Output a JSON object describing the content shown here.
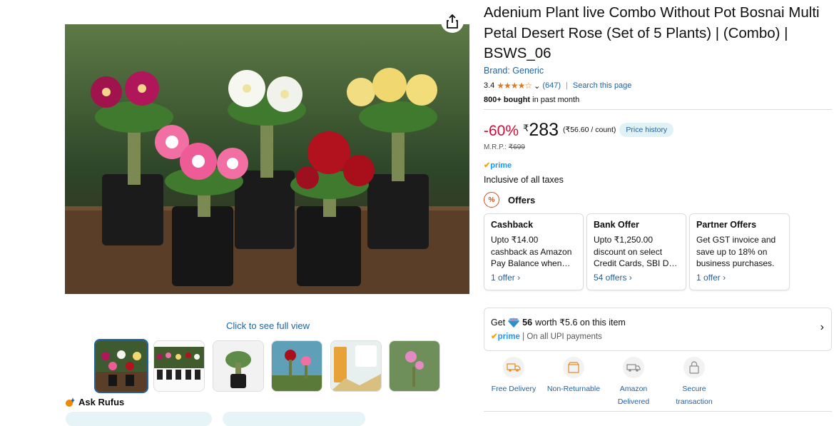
{
  "product": {
    "title": "Adenium Plant live Combo Without Pot Bosnai Multi Petal Desert Rose (Set of 5 Plants) | (Combo) | BSWS_06",
    "brand": "Brand: Generic",
    "rating": "3.4",
    "stars": "★★★★☆",
    "review_count": "(647)",
    "search_page": "Search this page",
    "bought_bold": "800+ bought",
    "bought_rest": " in past month"
  },
  "price": {
    "discount": "-60%",
    "currency": "₹",
    "amount": "283",
    "per_unit": "(₹56.60 / count)",
    "price_history": "Price history",
    "mrp_label": "M.R.P.: ",
    "mrp_value": "₹699",
    "prime_check": "✔",
    "prime": "prime",
    "taxes": "Inclusive of all taxes"
  },
  "offers": {
    "heading": "Offers",
    "icon": "%",
    "cards": [
      {
        "title": "Cashback",
        "body": "Upto ₹14.00 cashback as Amazon Pay Balance when…",
        "link": "1 offer ›"
      },
      {
        "title": "Bank Offer",
        "body": "Upto ₹1,250.00 discount on select Credit Cards, SBI D…",
        "link": "54 offers ›"
      },
      {
        "title": "Partner Offers",
        "body": "Get GST invoice and save up to 18% on business purchases.",
        "link": "1 offer ›"
      }
    ]
  },
  "supercoin": {
    "get": "Get",
    "coins": "56",
    "worth": "worth ₹5.6 on this item",
    "prime_check": "✔",
    "prime": "prime",
    "upi": " | On all UPI payments",
    "chevron": "›"
  },
  "features": [
    {
      "label": "Free Delivery",
      "icon": "truck-icon"
    },
    {
      "label": "Non-Returnable",
      "icon": "box-icon"
    },
    {
      "label": "Amazon Delivered",
      "icon": "van-icon"
    },
    {
      "label": "Secure transaction",
      "icon": "lock-icon"
    }
  ],
  "gallery": {
    "full_view": "Click to see full view",
    "rufus": "Ask Rufus"
  },
  "colors": {
    "link": "#2162A1",
    "deal": "#CC0C39",
    "star": "#DE7921",
    "prime": "#1A98FF"
  }
}
